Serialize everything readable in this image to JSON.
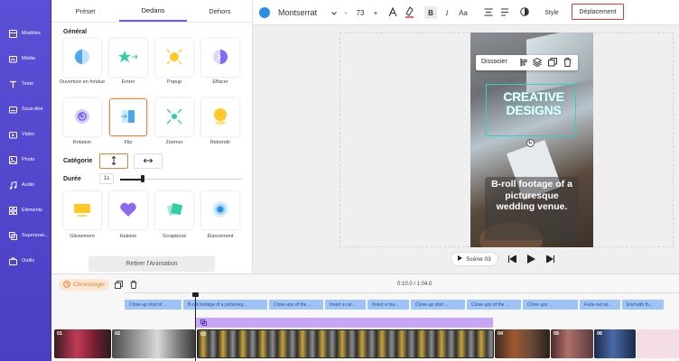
{
  "sidebar": {
    "items": [
      {
        "label": "Modèles",
        "icon": "template-icon"
      },
      {
        "label": "Média",
        "icon": "media-icon"
      },
      {
        "label": "Texte",
        "icon": "text-icon"
      },
      {
        "label": "Sous-titre",
        "icon": "subtitle-icon"
      },
      {
        "label": "Vidéo",
        "icon": "video-icon"
      },
      {
        "label": "Photo",
        "icon": "photo-icon"
      },
      {
        "label": "Audio",
        "icon": "audio-icon"
      },
      {
        "label": "Eléments",
        "icon": "elements-icon"
      },
      {
        "label": "Superposi...",
        "icon": "overlay-icon"
      },
      {
        "label": "Outils",
        "icon": "tools-icon"
      }
    ]
  },
  "panel": {
    "tabs": [
      "Préset",
      "Dedans",
      "Dehors"
    ],
    "section_general": "Général",
    "animations": [
      {
        "label": "Ouverture en fondue",
        "icon": "fade-icon"
      },
      {
        "label": "Entrer",
        "icon": "enter-icon"
      },
      {
        "label": "Popup",
        "icon": "popup-icon"
      },
      {
        "label": "Effacer",
        "icon": "wipe-icon"
      },
      {
        "label": "Rotation",
        "icon": "rotation-icon"
      },
      {
        "label": "Flip",
        "icon": "flip-icon"
      },
      {
        "label": "Zoomer",
        "icon": "zoom-icon"
      },
      {
        "label": "Rebondir",
        "icon": "bounce-icon"
      },
      {
        "label": "Glissement",
        "icon": "slide-icon"
      },
      {
        "label": "Haleine",
        "icon": "breath-icon"
      },
      {
        "label": "Scrapbook",
        "icon": "scrapbook-icon"
      },
      {
        "label": "Élancement",
        "icon": "pulse-icon"
      }
    ],
    "category_label": "Catégorie",
    "duration_label": "Durée",
    "duration_value": "1s",
    "remove_button": "Retirer l'Animation"
  },
  "toolbar": {
    "font": "Montserrat",
    "font_size": "73",
    "minus": "-",
    "plus": "+",
    "bold": "B",
    "italic": "I",
    "case": "Aa",
    "style_label": "Style",
    "motion_label": "Déplacement",
    "color": "#2d8de6"
  },
  "canvas": {
    "context_menu_label": "Dissocier",
    "headline": "CREATIVE DESIGNS",
    "caption": "B-roll footage of a picturesque wedding venue.",
    "scene_label": "Scène 03"
  },
  "timeline": {
    "label": "Chronologie",
    "time": "0:10.0 / 1:04.0",
    "subtitles": [
      "Close-up shot of ...",
      "B-roll footage of a picturesq...",
      "Close-ups of the ...",
      "Insert a cal...",
      "Insert a ma...",
      "Close-up shot ...",
      "Close-ups of the ...",
      "Close-ups ...",
      "Fade-out wi...",
      "End with th..."
    ],
    "clips": [
      "01",
      "02",
      "03",
      "04",
      "05",
      "06"
    ]
  }
}
